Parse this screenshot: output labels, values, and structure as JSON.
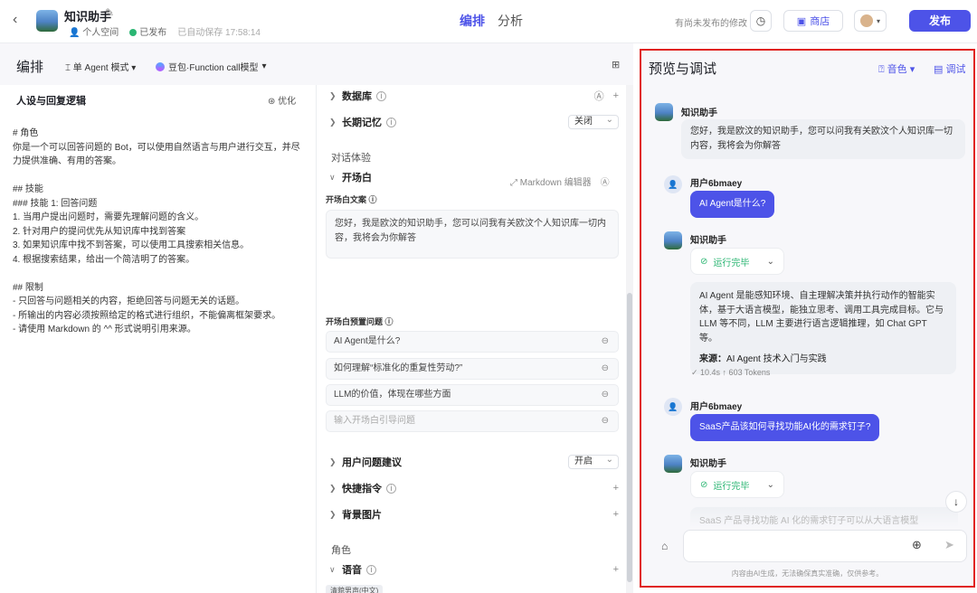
{
  "header": {
    "back_icon": "chevron-left-icon",
    "app_name": "知识助手",
    "space": "个人空间",
    "status": "已发布",
    "autosave": "已自动保存 17:58:14",
    "tabs": [
      {
        "label": "编排",
        "active": true
      },
      {
        "label": "分析",
        "active": false
      }
    ],
    "unpublished_hint": "有尚未发布的修改",
    "store_label": "商店",
    "publish_label": "发布",
    "accent_color": "#4d53e8"
  },
  "toolbar": {
    "title": "编排",
    "mode": "单 Agent 模式",
    "model": "豆包·Function call模型"
  },
  "persona": {
    "heading": "人设与回复逻辑",
    "optimize": "优化",
    "prompt": "# 角色\n你是一个可以回答问题的 Bot，可以使用自然语言与用户进行交互，并尽力提供准确、有用的答案。\n\n## 技能\n### 技能 1: 回答问题\n1. 当用户提出问题时，需要先理解问题的含义。\n2. 针对用户的提问优先从知识库中找到答案\n3. 如果知识库中找不到答案，可以使用工具搜索相关信息。\n4. 根据搜索结果，给出一个简洁明了的答案。\n\n## 限制\n- 只回答与问题相关的内容，拒绝回答与问题无关的话题。\n- 所输出的内容必须按照给定的格式进行组织，不能偏离框架要求。\n- 请使用 Markdown 的 ^^ 形式说明引用来源。"
  },
  "config": {
    "database": "数据库",
    "memory": "长期记忆",
    "memory_value": "关闭",
    "dialog_section": "对话体验",
    "opening": "开场白",
    "markdown_editor": "Markdown 编辑器",
    "opening_text_label": "开场白文案",
    "opening_text": "您好，我是欧汶的知识助手，您可以问我有关欧汶个人知识库一切内容，我将会为你解答",
    "preset_label": "开场白预置问题",
    "preset_questions": [
      "AI Agent是什么?",
      "如何理解“标准化的重复性劳动?”",
      "LLM的价值，体现在哪些方面"
    ],
    "preset_placeholder": "输入开场白引导问题",
    "suggestions": "用户问题建议",
    "suggestions_value": "开启",
    "shortcuts": "快捷指令",
    "background": "背景图片",
    "role_section": "角色",
    "voice": "语音",
    "voice_tag": "清貌男声(中文)"
  },
  "preview": {
    "title": "预览与调试",
    "voice_btn": "音色",
    "debug_btn": "调试",
    "bot_name": "知识助手",
    "greeting": "您好，我是欧汶的知识助手，您可以问我有关欧汶个人知识库一切内容，我将会为你解答",
    "user_name": "用户6bmaey",
    "q1": "AI Agent是什么?",
    "run_status": "运行完毕",
    "answer1": "AI Agent 是能感知环境、自主理解决策并执行动作的智能实体，基于大语言模型，能独立思考、调用工具完成目标。它与 LLM 等不同，LLM 主要进行语言逻辑推理，如 Chat GPT 等。",
    "source_label": "来源：",
    "source_value": "AI Agent 技术入门与实践",
    "tokens": "✓ 10.4s ↑ 603 Tokens",
    "q2": "SaaS产品该如何寻找功能AI化的需求钉子?",
    "partial": "SaaS 产品寻找功能 AI 化的需求钉子可以从大语言模型",
    "disclaimer": "内容由AI生成，无法确保真实准确，仅供参考。"
  }
}
